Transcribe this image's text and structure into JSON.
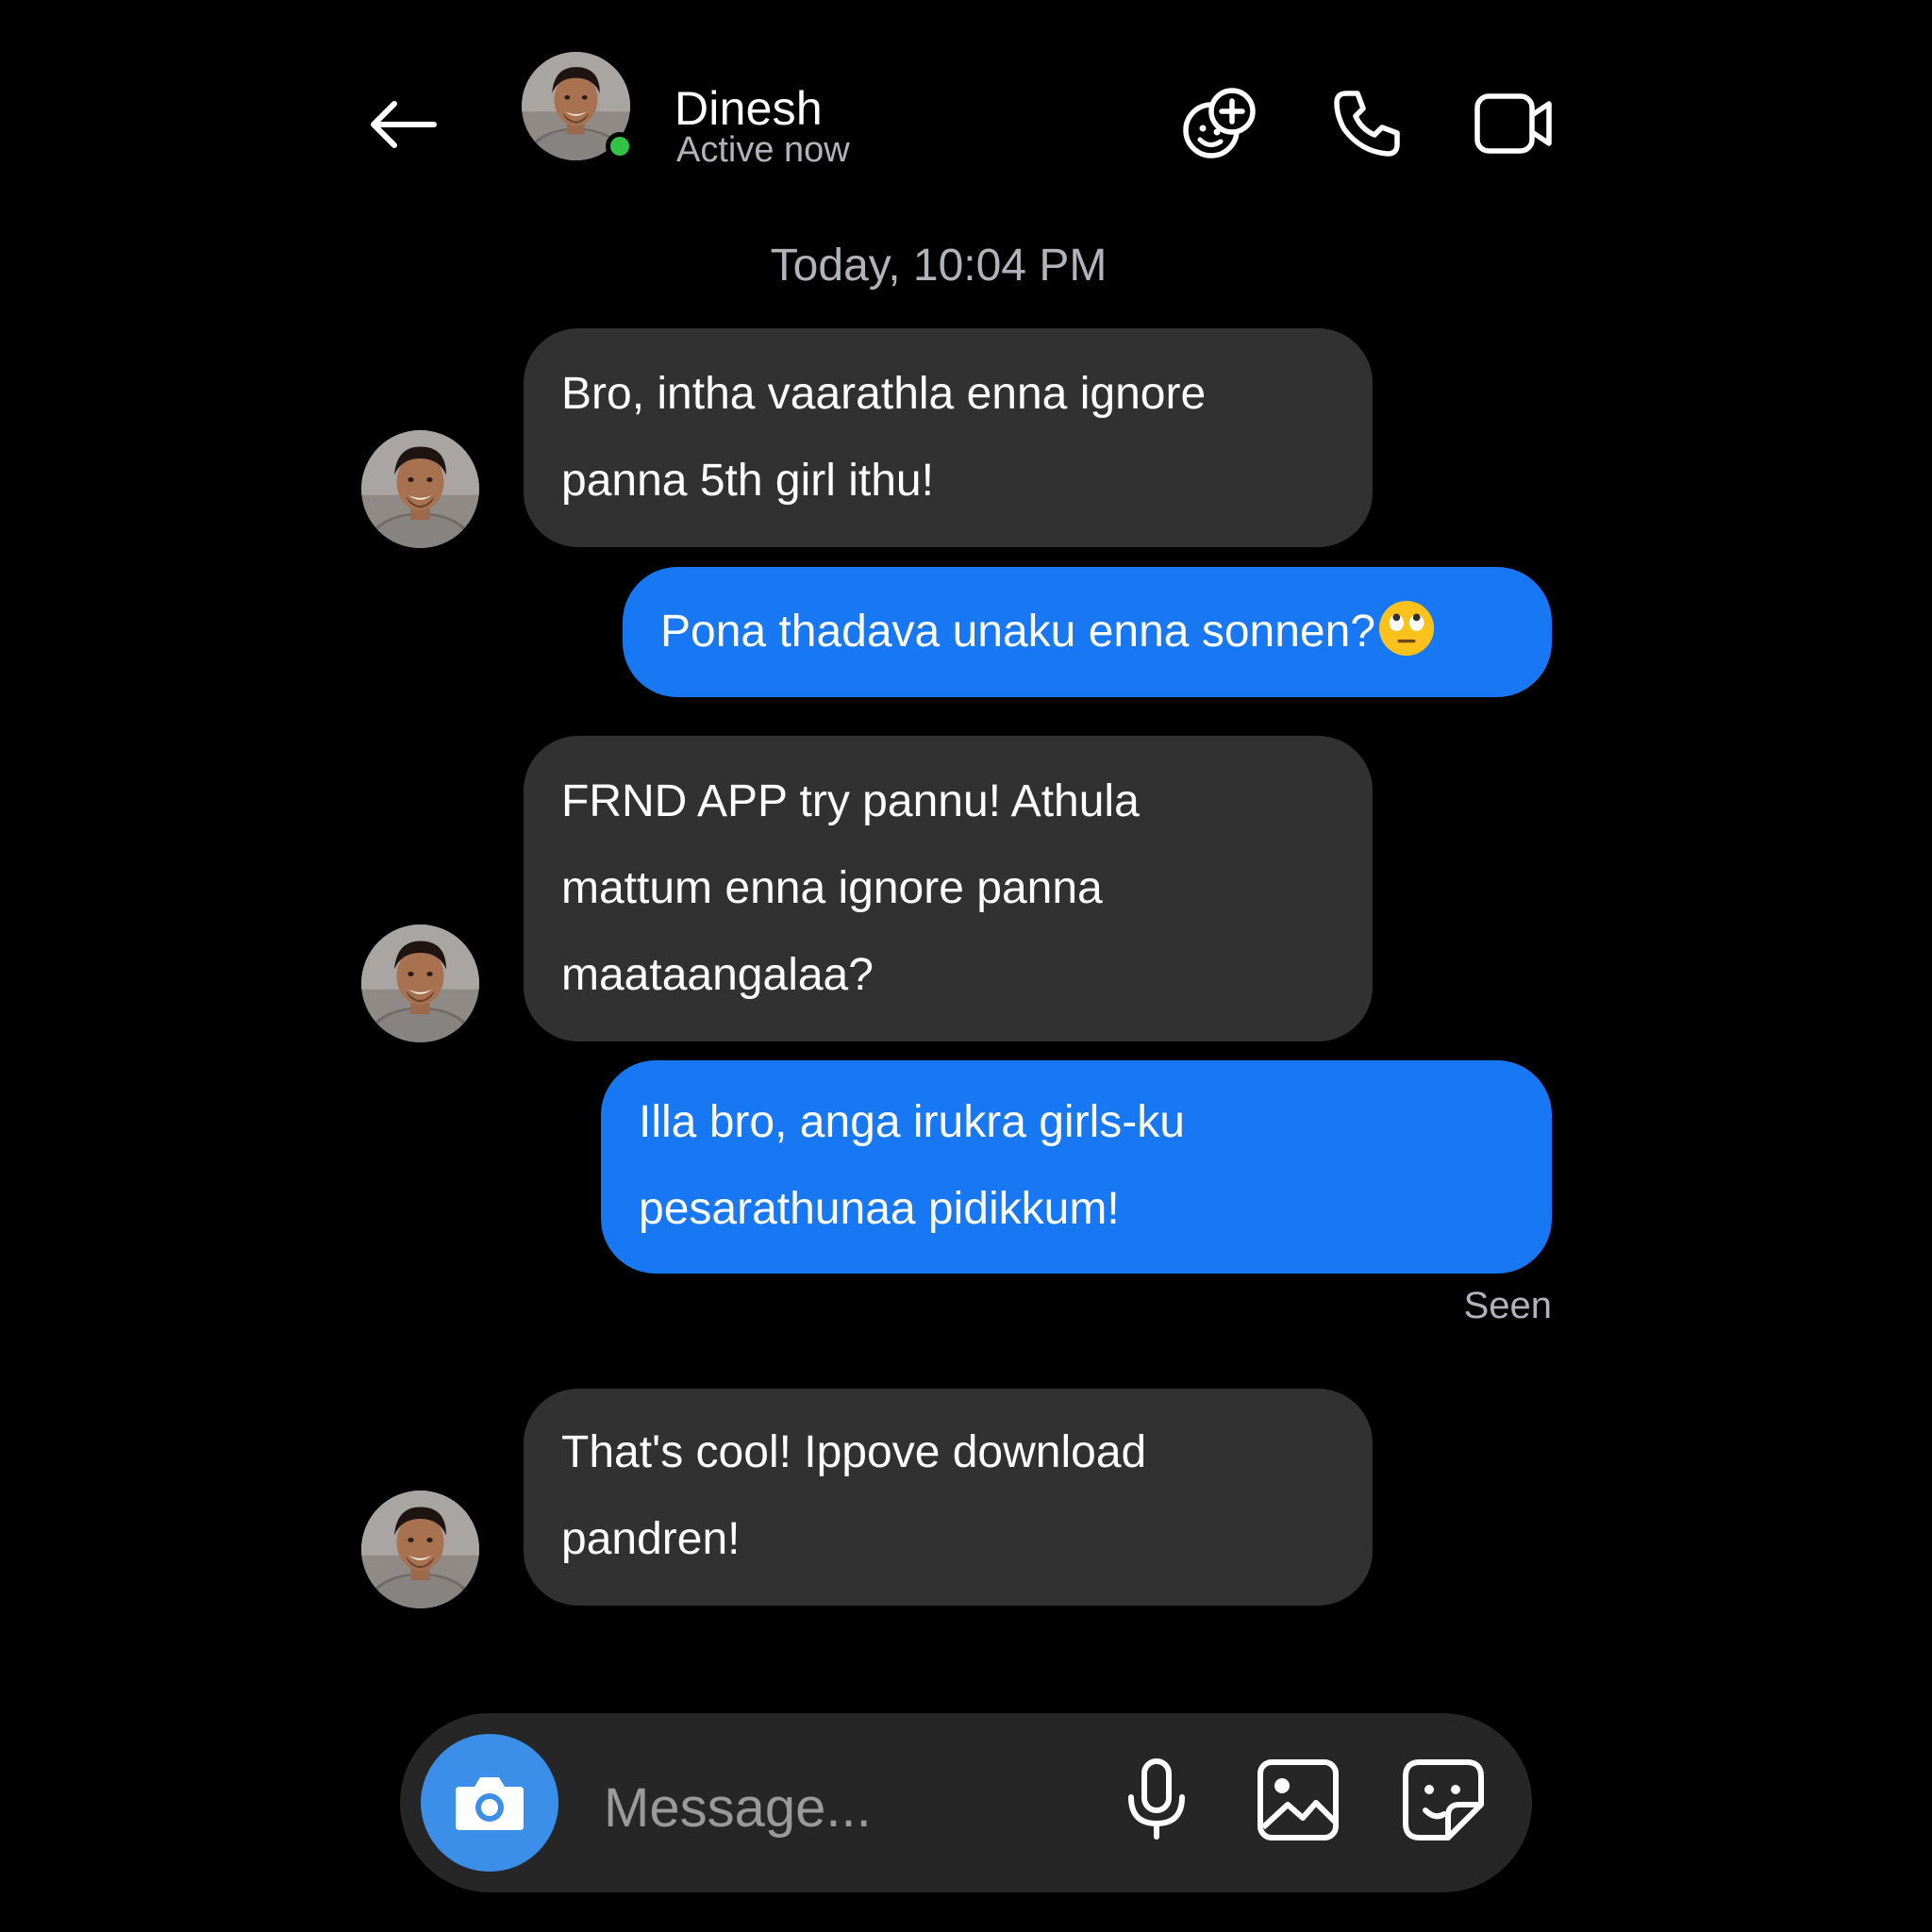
{
  "header": {
    "back_icon": "arrow-left-icon",
    "contact_name": "Dinesh",
    "status": "Active now",
    "online_color": "#31c345",
    "actions": [
      "effects-icon",
      "phone-icon",
      "video-camera-icon"
    ]
  },
  "timestamp": "Today, 10:04 PM",
  "messages": [
    {
      "from": "contact",
      "lines": [
        "Bro, intha vaarathla enna ignore",
        "panna 5th girl ithu!"
      ]
    },
    {
      "from": "me",
      "lines": [
        "Pona thadava unaku enna sonnen?"
      ],
      "emoji": "eye-roll-emoji"
    },
    {
      "from": "contact",
      "lines": [
        "FRND APP try pannu! Athula",
        "mattum enna ignore panna",
        "maataangalaa?"
      ]
    },
    {
      "from": "me",
      "lines": [
        "Illa bro, anga irukra girls-ku",
        "pesarathunaa pidikkum!"
      ]
    },
    {
      "from": "contact",
      "lines": [
        "That's cool! Ippove download",
        "pandren!"
      ]
    }
  ],
  "receipt": "Seen",
  "composer": {
    "placeholder": "Message...",
    "icons": [
      "camera-icon",
      "microphone-icon",
      "gallery-icon",
      "sticker-icon"
    ]
  },
  "colors": {
    "background": "#000000",
    "incoming_bubble": "#313131",
    "outgoing_bubble": "#1877f2",
    "camera_button": "#3b8fe8",
    "secondary_text": "#b0b3b8"
  }
}
